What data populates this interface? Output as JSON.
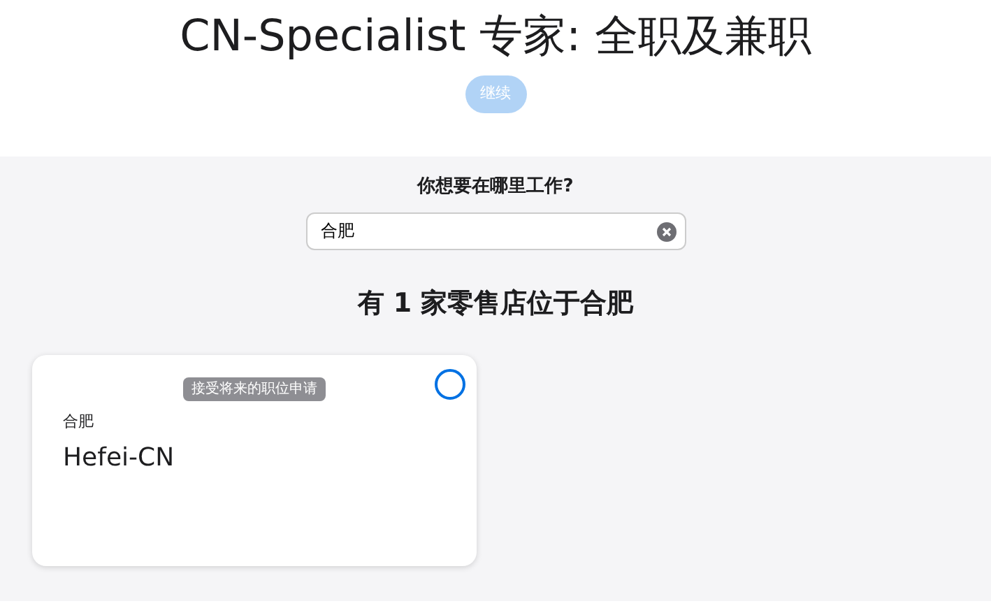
{
  "title": "CN-Specialist 专家: 全职及兼职",
  "continue_button": {
    "label": "继续",
    "disabled": true
  },
  "location_prompt": "你想要在哪里工作?",
  "search": {
    "value": "合肥"
  },
  "result_heading": "有 1 家零售店位于合肥",
  "stores": [
    {
      "badge": "接受将来的职位申请",
      "city": "合肥",
      "name": "Hefei-CN",
      "selected": false
    }
  ]
}
